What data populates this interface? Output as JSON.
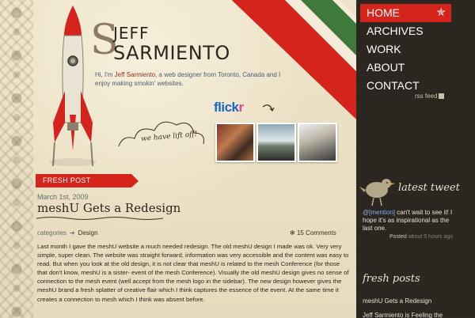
{
  "nav": {
    "items": [
      {
        "label": "HOME",
        "active": true
      },
      {
        "label": "ARCHIVES"
      },
      {
        "label": "WORK"
      },
      {
        "label": "ABOUT"
      },
      {
        "label": "CONTACT"
      }
    ],
    "active_icon": "star-icon",
    "star_glyph": "✯"
  },
  "sidebar": {
    "rss_label": "rss feed",
    "latest_tweet": {
      "title": "latest tweet",
      "handle": "@[mention]",
      "text": " can't wait to see it! I hope it's as inspirational as the last one.",
      "posted_label": "Posted",
      "ago": "about 5 hours ago"
    },
    "fresh_posts": {
      "title": "fresh posts",
      "items": [
        "meshU Gets a Redesign",
        "Jeff Sarmiento is Feeling the"
      ]
    }
  },
  "header": {
    "logo_s": "S",
    "first_name": "JEFF",
    "last_name": "SARMIENTO",
    "intro_pre": "Hi, I'm ",
    "intro_name": "Jeff Sarmiento",
    "intro_post": ", a web designer from Toronto, Canada and I enjoy making smokin' websites.",
    "flickr_main": "flick",
    "flickr_r": "r",
    "cloud_text": "we have lift off!"
  },
  "post": {
    "badge": "FRESH POST",
    "date": "March 1st, 2009",
    "title": "meshU Gets a Redesign",
    "categories_label": "categories",
    "arrow": "➔",
    "category": "Design",
    "comments": "15 Comments",
    "body": "Last month I gave the meshU website a much needed redesign. The old meshU design I made was ok. Very very simple, super clean. The website was straight forward, information was very accessible and the content was easy to read. But when you look at the old design, it is not clear that meshU is related to the mesh Conference (for those that don't know, meshU is a sister- event of the mesh Conference). Visually the old meshU design gives no sense of connection to the mesh event (well accept from the mesh logo in the sidebar). The new design however gives the meshU brand a fresh splatter of creative flair which I think captures the essence of the event. At the same time it creates a connection to mesh which I think was absent before."
  },
  "colors": {
    "accent_red": "#d4241c",
    "accent_green": "#3f7a3a",
    "sidebar_bg": "#2b2520",
    "paper": "#e7dcc0"
  }
}
